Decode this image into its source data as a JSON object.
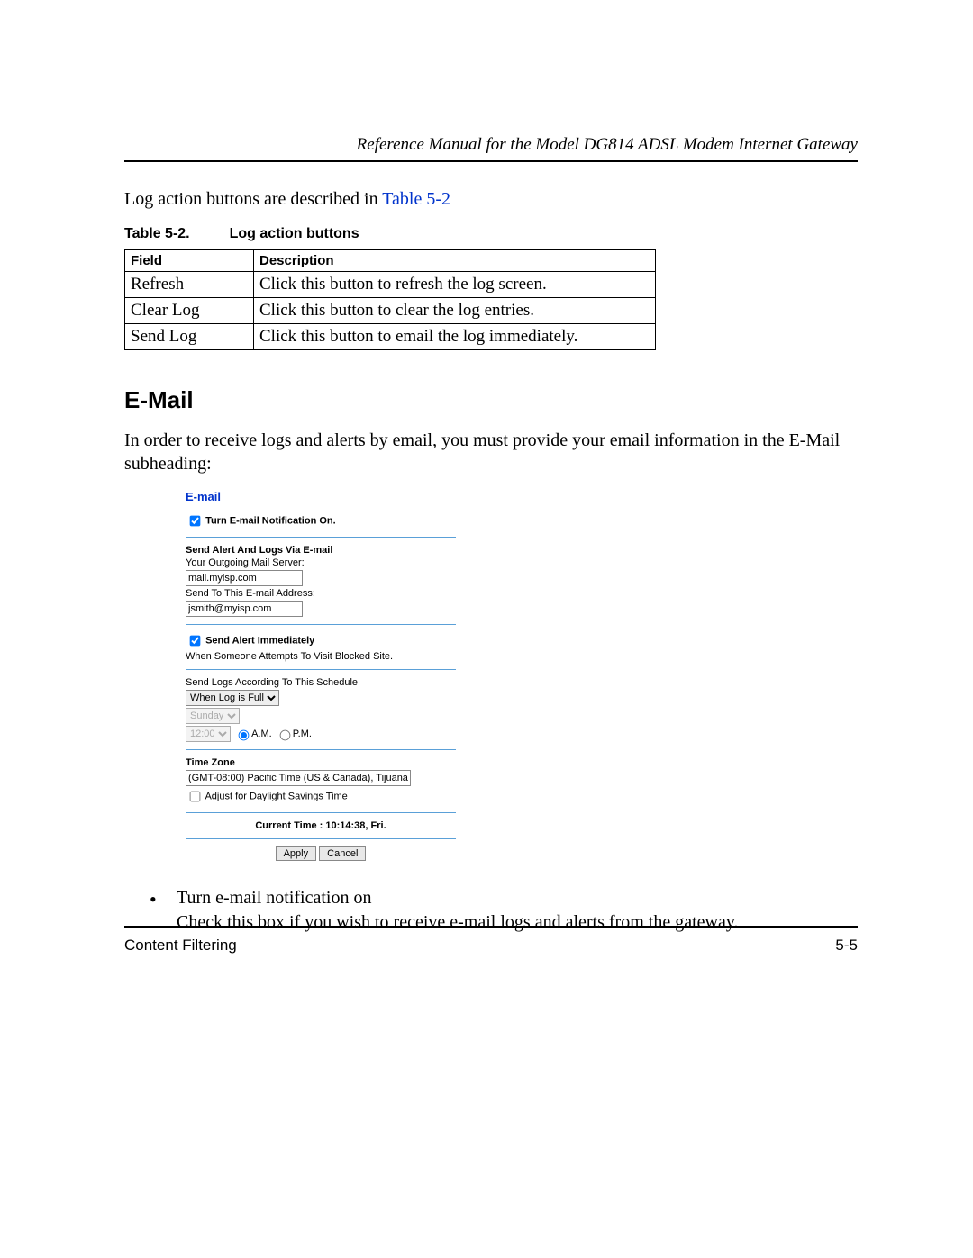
{
  "header": {
    "title": "Reference Manual for the Model DG814 ADSL Modem Internet Gateway"
  },
  "intro_prefix": "Log action buttons are described in ",
  "intro_link": "Table 5-2",
  "caption_number": "Table 5-2.",
  "caption_text": "Log action buttons",
  "table": {
    "headers": {
      "field": "Field",
      "description": "Description"
    },
    "rows": [
      {
        "field": "Refresh",
        "description": "Click this button to refresh the log screen."
      },
      {
        "field": "Clear Log",
        "description": "Click this button to clear the log entries."
      },
      {
        "field": "Send Log",
        "description": "Click this button to email the log immediately."
      }
    ]
  },
  "section_title": "E-Mail",
  "section_para": "In order to receive logs and alerts by email, you must provide your email information in the E-Mail subheading:",
  "shot": {
    "title": "E-mail",
    "notify_label": "Turn E-mail Notification On.",
    "send_header": "Send Alert And Logs Via E-mail",
    "mail_server_label": "Your Outgoing Mail Server:",
    "mail_server_value": "mail.myisp.com",
    "email_addr_label": "Send To This E-mail Address:",
    "email_addr_value": "jsmith@myisp.com",
    "alert_immediately": "Send Alert Immediately",
    "alert_sub": "When Someone Attempts To Visit Blocked Site.",
    "schedule_label": "Send Logs According To This Schedule",
    "schedule_select": "When Log is Full",
    "day_select": "Sunday",
    "time_select": "12:00",
    "am_label": "A.M.",
    "pm_label": "P.M.",
    "timezone_header": "Time Zone",
    "timezone_value": "(GMT-08:00) Pacific Time (US & Canada), Tijuana",
    "daylight_label": "Adjust for Daylight Savings Time",
    "current_time_label": "Current Time : 10:14:38, Fri.",
    "apply": "Apply",
    "cancel": "Cancel"
  },
  "bullet": {
    "title": "Turn e-mail notification on",
    "body": "Check this box if you wish to receive e-mail logs and alerts from the gateway."
  },
  "footer": {
    "left": "Content Filtering",
    "right": "5-5"
  }
}
